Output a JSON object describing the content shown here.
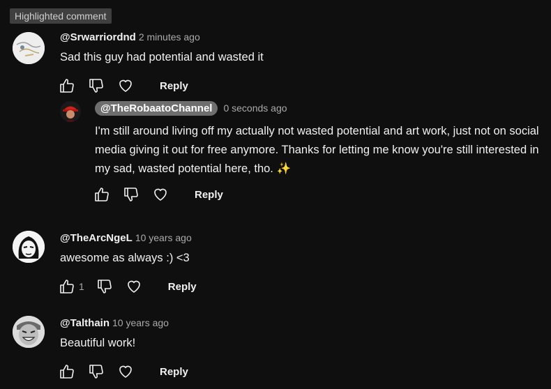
{
  "badge": "Highlighted comment",
  "comments": [
    {
      "author": "@Srwarriordnd",
      "time": "2 minutes ago",
      "text": "Sad this guy had potential and wasted it",
      "likes": "",
      "reply_label": "Reply",
      "avatar": "sketch-avatar"
    },
    {
      "author": "@TheRobaatoChannel",
      "time": "0 seconds ago",
      "text": "I'm still around living off my actually not wasted potential and art work, just not on social media giving it out for free anymore. Thanks for letting me know you're still interested in my sad, wasted potential here, tho. ✨",
      "likes": "",
      "reply_label": "Reply",
      "avatar": "red-hat-avatar"
    },
    {
      "author": "@TheArcNgeL",
      "time": "10 years ago",
      "text": "awesome as always :) <3",
      "likes": "1",
      "reply_label": "Reply",
      "avatar": "hooded-face-avatar"
    },
    {
      "author": "@Talthain",
      "time": "10 years ago",
      "text": "Beautiful work!",
      "likes": "",
      "reply_label": "Reply",
      "avatar": "grinning-face-avatar"
    }
  ],
  "icons": [
    "thumbs-up-icon",
    "thumbs-down-icon",
    "heart-icon"
  ]
}
